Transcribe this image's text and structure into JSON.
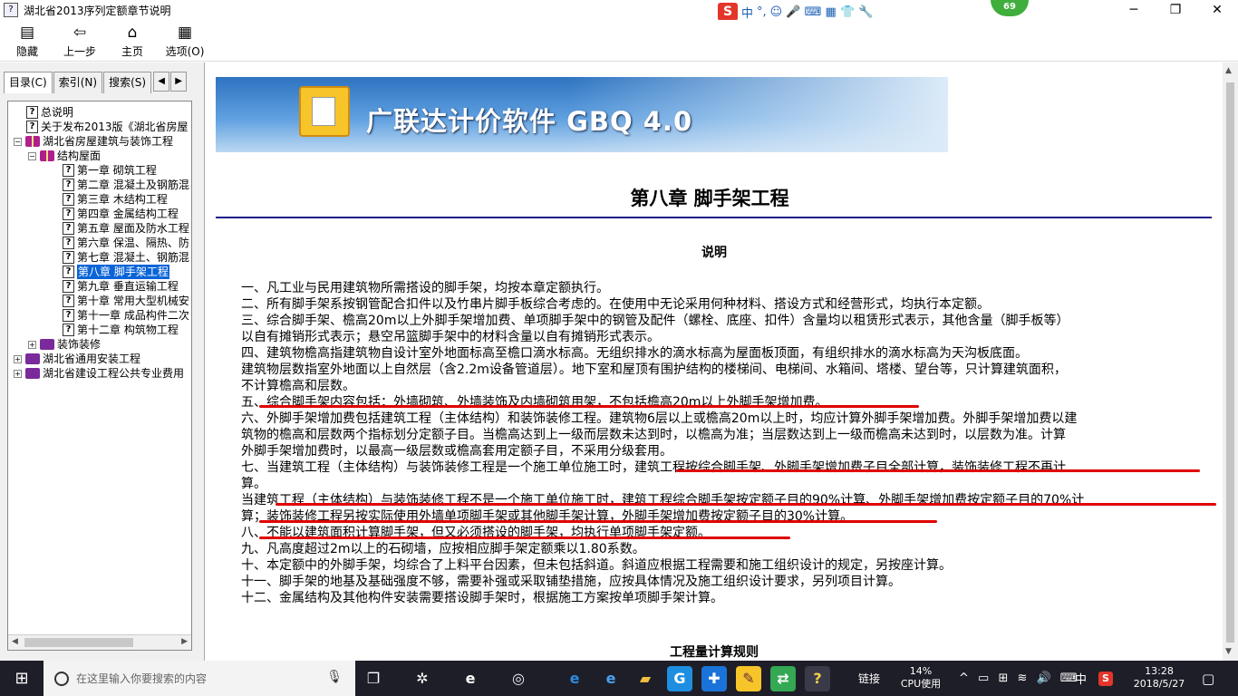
{
  "window": {
    "title": "湖北省2013序列定额章节说明",
    "minimize": "─",
    "maximize": "❐",
    "close": "✕"
  },
  "ime": {
    "logo": "S",
    "mode": "中",
    "punct": "°,",
    "icons": "☺ 🎤 ⌨ ▦ 👕 🔧"
  },
  "badge": "69",
  "toolbar": [
    {
      "label": "隐藏",
      "icon": "hide-icon",
      "glyph": "▤"
    },
    {
      "label": "上一步",
      "icon": "back-arrow-icon",
      "glyph": "⇦"
    },
    {
      "label": "主页",
      "icon": "home-icon",
      "glyph": "⌂"
    },
    {
      "label": "选项(O)",
      "icon": "options-icon",
      "glyph": "▦"
    }
  ],
  "tabs": [
    "目录(C)",
    "索引(N)",
    "搜索(S)"
  ],
  "tree": [
    {
      "label": "总说明",
      "level": 2,
      "type": "page"
    },
    {
      "label": "关于发布2013版《湖北省房屋",
      "level": 2,
      "type": "page"
    },
    {
      "label": "湖北省房屋建筑与装饰工程",
      "level": 1,
      "type": "book-open",
      "exp": "−"
    },
    {
      "label": "结构屋面",
      "level": 2,
      "type": "book-open",
      "exp": "−"
    },
    {
      "label": "第一章 砌筑工程",
      "level": 3,
      "type": "page"
    },
    {
      "label": "第二章 混凝土及钢筋混",
      "level": 3,
      "type": "page"
    },
    {
      "label": "第三章 木结构工程",
      "level": 3,
      "type": "page"
    },
    {
      "label": "第四章 金属结构工程",
      "level": 3,
      "type": "page"
    },
    {
      "label": "第五章 屋面及防水工程",
      "level": 3,
      "type": "page"
    },
    {
      "label": "第六章 保温、隔热、防",
      "level": 3,
      "type": "page"
    },
    {
      "label": "第七章 混凝土、钢筋混",
      "level": 3,
      "type": "page"
    },
    {
      "label": "第八章 脚手架工程",
      "level": 3,
      "type": "page",
      "selected": true
    },
    {
      "label": "第九章 垂直运输工程",
      "level": 3,
      "type": "page"
    },
    {
      "label": "第十章 常用大型机械安",
      "level": 3,
      "type": "page"
    },
    {
      "label": "第十一章 成品构件二次",
      "level": 3,
      "type": "page"
    },
    {
      "label": "第十二章 构筑物工程",
      "level": 3,
      "type": "page"
    },
    {
      "label": "装饰装修",
      "level": 2,
      "type": "book",
      "exp": "+"
    },
    {
      "label": "湖北省通用安装工程",
      "level": 1,
      "type": "book",
      "exp": "+"
    },
    {
      "label": "湖北省建设工程公共专业费用",
      "level": 1,
      "type": "book",
      "exp": "+"
    }
  ],
  "banner": {
    "text": "广联达计价软件 GBQ 4.0"
  },
  "chapter_title": "第八章  脚手架工程",
  "subtitle": "说明",
  "paragraphs": [
    "一、凡工业与民用建筑物所需搭设的脚手架，均按本章定额执行。",
    "二、所有脚手架系按钢管配合扣件以及竹串片脚手板综合考虑的。在使用中无论采用何种材料、搭设方式和经营形式，均执行本定额。",
    "三、综合脚手架、檐高20m以上外脚手架增加费、单项脚手架中的钢管及配件（螺栓、底座、扣件）含量均以租赁形式表示，其他含量（脚手板等）",
    "以自有摊销形式表示；悬空吊篮脚手架中的材料含量以自有摊销形式表示。",
    "四、建筑物檐高指建筑物自设计室外地面标高至檐口滴水标高。无组织排水的滴水标高为屋面板顶面，有组织排水的滴水标高为天沟板底面。",
    "建筑物层数指室外地面以上自然层（含2.2m设备管道层）。地下室和屋顶有围护结构的楼梯间、电梯间、水箱间、塔楼、望台等，只计算建筑面积，",
    "不计算檐高和层数。",
    "五、综合脚手架内容包括：外墙砌筑、外墙装饰及内墙砌筑用架，不包括檐高20m以上外脚手架增加费。",
    "六、外脚手架增加费包括建筑工程（主体结构）和装饰装修工程。建筑物6层以上或檐高20m以上时，均应计算外脚手架增加费。外脚手架增加费以建",
    "筑物的檐高和层数两个指标划分定额子目。当檐高达到上一级而层数未达到时，以檐高为准；当层数达到上一级而檐高未达到时，以层数为准。计算",
    "外脚手架增加费时，以最高一级层数或檐高套用定额子目，不采用分级套用。",
    "七、当建筑工程（主体结构）与装饰装修工程是一个施工单位施工时，建筑工程按综合脚手架、外脚手架增加费子目全部计算，装饰装修工程不再计",
    "算。",
    "当建筑工程（主体结构）与装饰装修工程不是一个施工单位施工时，建筑工程综合脚手架按定额子目的90%计算、外脚手架增加费按定额子目的70%计",
    "算；装饰装修工程另按实际使用外墙单项脚手架或其他脚手架计算，外脚手架增加费按定额子目的30%计算。",
    "八、不能以建筑面积计算脚手架，但又必须搭设的脚手架，均执行单项脚手架定额。",
    "九、凡高度超过2m以上的石砌墙，应按相应脚手架定额乘以1.80系数。",
    "十、本定额中的外脚手架，均综合了上料平台因素，但未包括斜道。斜道应根据工程需要和施工组织设计的规定，另按座计算。",
    "十一、脚手架的地基及基础强度不够，需要补强或采取铺垫措施，应按具体情况及施工组织设计要求，另列项目计算。",
    "十二、金属结构及其他构件安装需要搭设脚手架时，根据施工方案按单项脚手架计算。"
  ],
  "rules_title": "工程量计算规则",
  "taskbar": {
    "search_placeholder": "在这里输入你要搜索的内容",
    "apps": [
      {
        "name": "task-view-icon",
        "glyph": "❐",
        "color": "#1e1e28",
        "fg": "#fff"
      },
      {
        "name": "fan-app-icon",
        "glyph": "✲",
        "color": "#1e1e28",
        "fg": "#fff"
      },
      {
        "name": "edge-icon",
        "glyph": "e",
        "color": "#1e1e28",
        "fg": "#fff"
      },
      {
        "name": "browser-icon",
        "glyph": "◎",
        "color": "#1e1e28",
        "fg": "#eee"
      },
      {
        "name": "edge-blue-icon",
        "glyph": "e",
        "color": "#1e1e28",
        "fg": "#2a8be0"
      },
      {
        "name": "ie-icon",
        "glyph": "e",
        "color": "#1e1e28",
        "fg": "#4aa0f0"
      },
      {
        "name": "folder-icon",
        "glyph": "▰",
        "color": "#1e1e28",
        "fg": "#f0c040"
      },
      {
        "name": "g-app-icon",
        "glyph": "G",
        "color": "#1e8fe0",
        "fg": "#fff"
      },
      {
        "name": "plus-app-icon",
        "glyph": "✚",
        "color": "#1a73d9",
        "fg": "#fff"
      },
      {
        "name": "gbq-app-icon",
        "glyph": "✎",
        "color": "#f7c42a",
        "fg": "#633"
      },
      {
        "name": "green-app-icon",
        "glyph": "⇄",
        "color": "#34a853",
        "fg": "#fff"
      },
      {
        "name": "help-app-icon",
        "glyph": "?",
        "color": "#3a3a48",
        "fg": "#f5d04a"
      }
    ],
    "link_label": "链接",
    "cpu_value": "14%",
    "cpu_label": "CPU使用",
    "tray_icons": "^ ▭ ⊞ ≋ 🔊 ⌨",
    "lang": "中",
    "time": "13:28",
    "date": "2018/5/27",
    "notify": "▢"
  }
}
